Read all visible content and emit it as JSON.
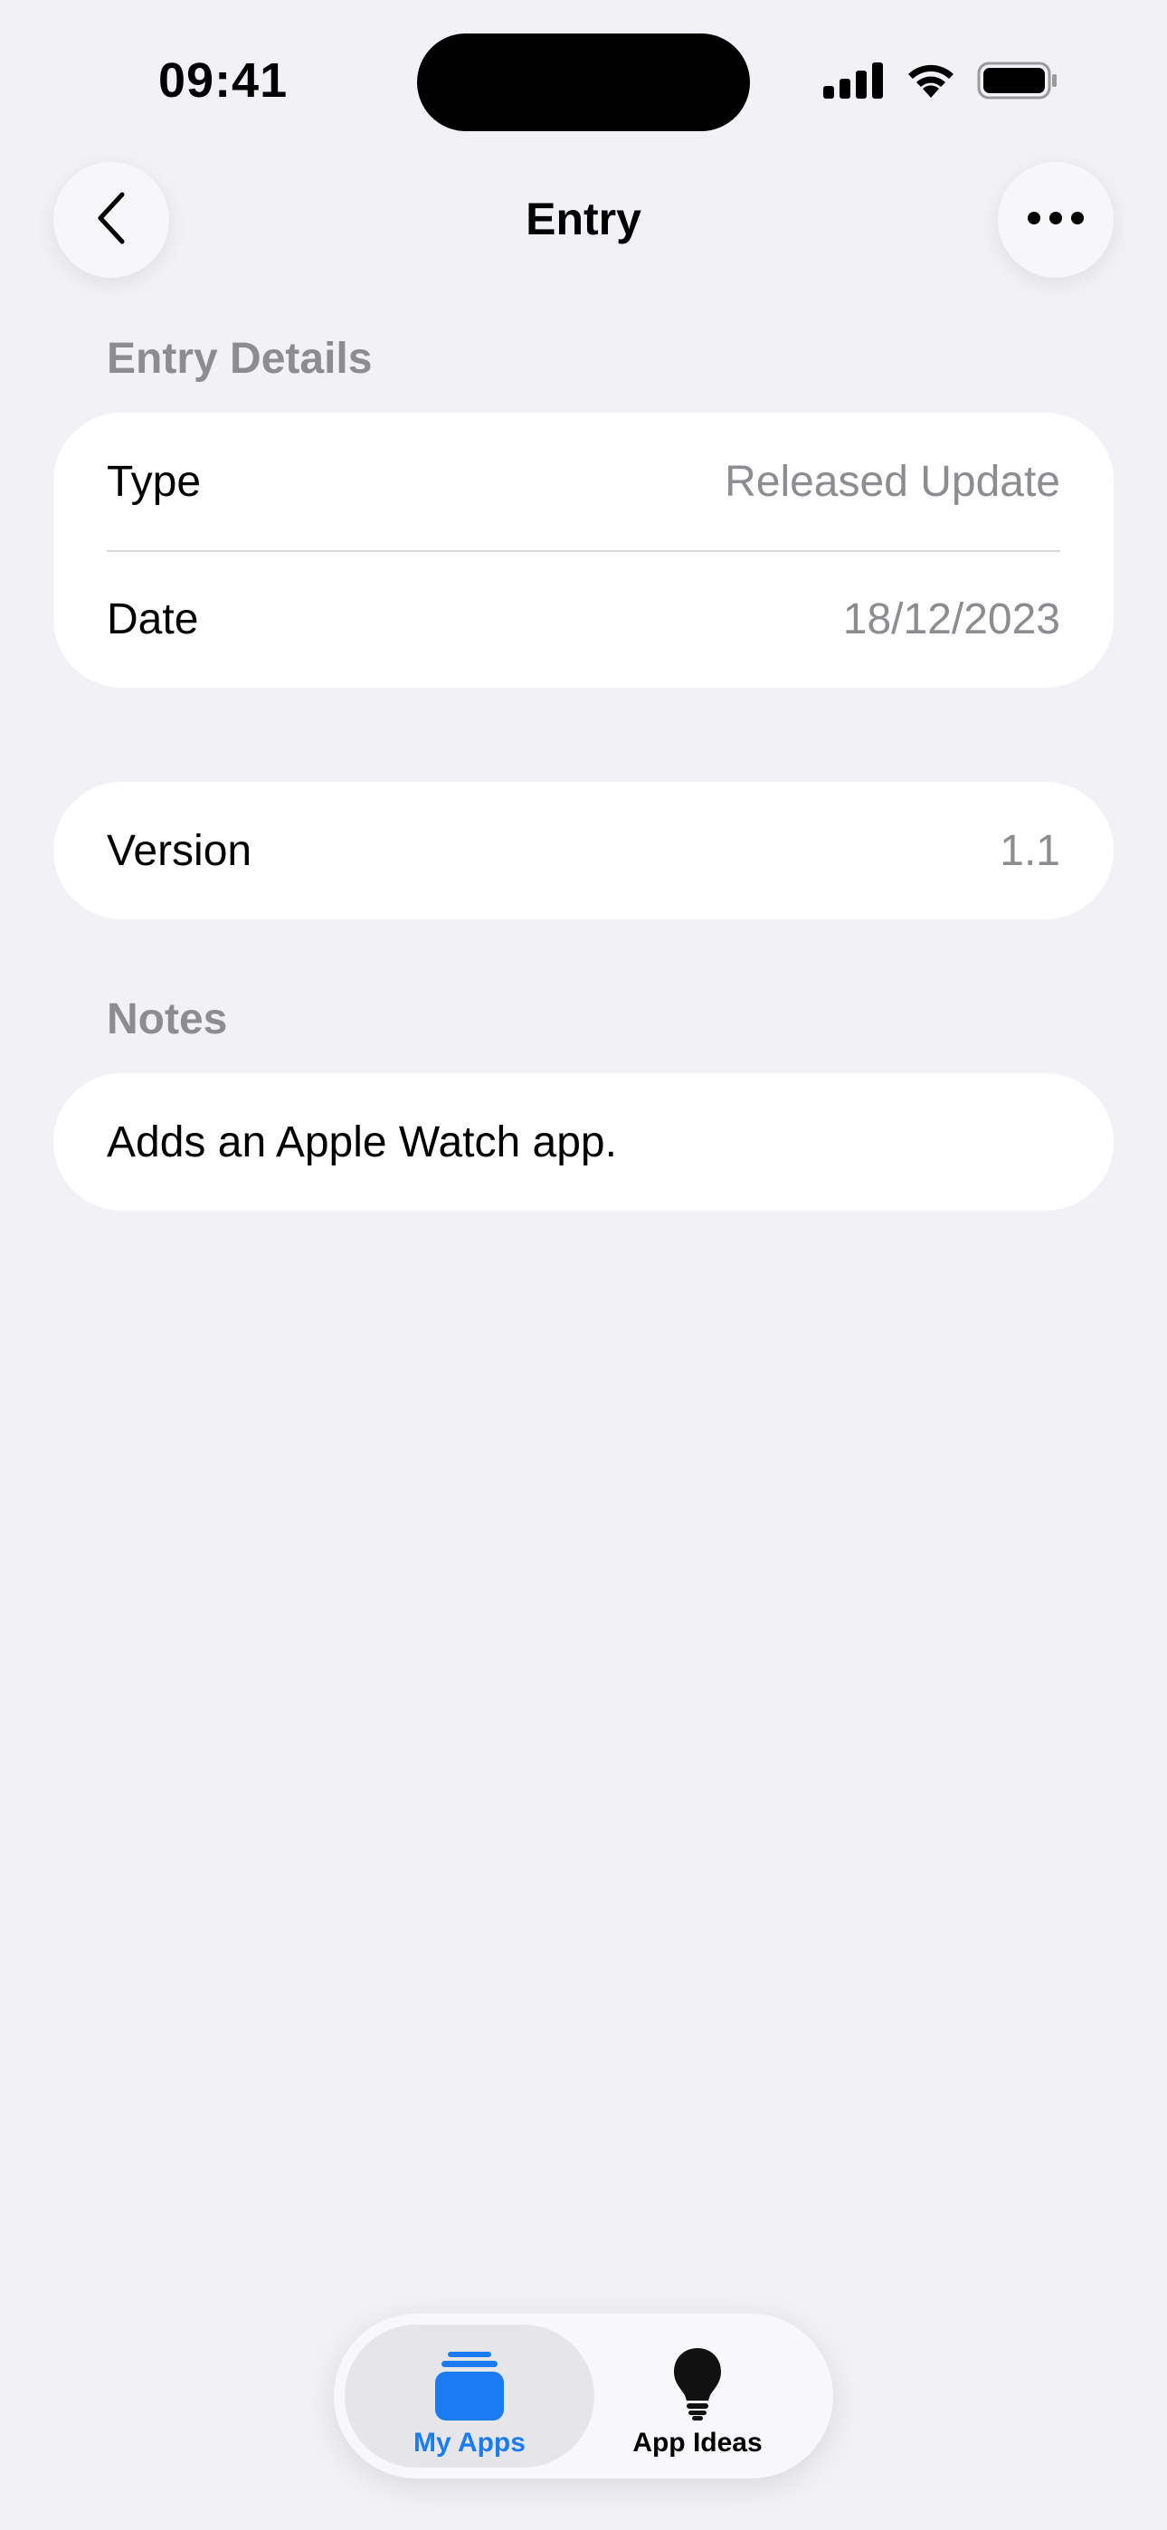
{
  "status_bar": {
    "time": "09:41"
  },
  "nav": {
    "title": "Entry",
    "back_icon": "chevron-left-icon",
    "more_icon": "ellipsis-icon"
  },
  "sections": {
    "details_header": "Entry Details",
    "details_rows": [
      {
        "label": "Type",
        "value": "Released Update"
      },
      {
        "label": "Date",
        "value": "18/12/2023"
      }
    ],
    "version_row": {
      "label": "Version",
      "value": "1.1"
    },
    "notes_header": "Notes",
    "notes_text": "Adds an Apple Watch app."
  },
  "tab_bar": {
    "tabs": [
      {
        "label": "My Apps",
        "icon": "stack-icon",
        "selected": true
      },
      {
        "label": "App Ideas",
        "icon": "lightbulb-icon",
        "selected": false
      }
    ]
  },
  "colors": {
    "background": "#f2f1f6",
    "accent": "#1a7bf2",
    "secondary_text": "#8c8c91"
  }
}
